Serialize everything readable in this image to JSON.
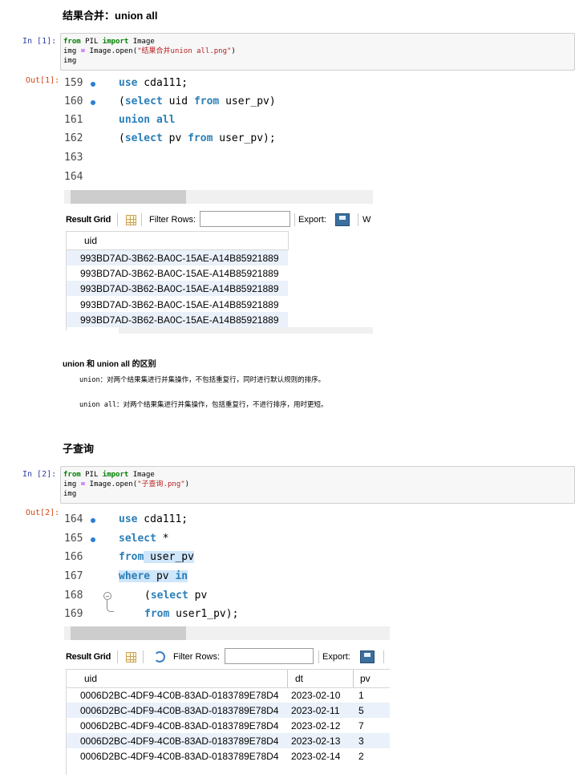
{
  "section1": {
    "heading": "结果合并：union all",
    "in_prompt": "In  [1]:",
    "out_prompt": "Out[1]:",
    "code": {
      "l1_kw1": "from",
      "l1_mod": " PIL ",
      "l1_kw2": "import",
      "l1_rest": " Image",
      "l2_a": "img ",
      "l2_eq": "=",
      "l2_b": " Image.open(",
      "l2_str": "\"结果合并union all.png\"",
      "l2_c": ")",
      "l3": "img"
    },
    "editor": {
      "lines": [
        {
          "num": "159",
          "dot": true,
          "kw": "use",
          "rest": " cda111;"
        },
        {
          "num": "160",
          "dot": true,
          "kw": "",
          "rest": ""
        },
        {
          "num": "161",
          "dot": false,
          "kw": "union all",
          "rest": ""
        },
        {
          "num": "162",
          "dot": false,
          "kw": "",
          "rest": ""
        },
        {
          "num": "163",
          "dot": false,
          "kw": "",
          "rest": ""
        },
        {
          "num": "164",
          "dot": false,
          "kw": "",
          "rest": ""
        }
      ],
      "line160": {
        "p1": "(",
        "k1": "select",
        "p2": " uid ",
        "k2": "from",
        "p3": " user_pv)"
      },
      "line162": {
        "p1": "(",
        "k1": "select",
        "p2": " pv ",
        "k2": "from",
        "p3": " user_pv);"
      }
    },
    "toolbar": {
      "result_grid": "Result Grid",
      "filter_rows": "Filter Rows:",
      "export": "Export:",
      "trailing": "W"
    },
    "grid": {
      "columns": [
        "uid"
      ],
      "rows": [
        [
          "993BD7AD-3B62-BA0C-15AE-A14B85921889"
        ],
        [
          "993BD7AD-3B62-BA0C-15AE-A14B85921889"
        ],
        [
          "993BD7AD-3B62-BA0C-15AE-A14B85921889"
        ],
        [
          "993BD7AD-3B62-BA0C-15AE-A14B85921889"
        ],
        [
          "993BD7AD-3B62-BA0C-15AE-A14B85921889"
        ]
      ]
    }
  },
  "diff": {
    "title": "union 和 union all 的区别",
    "union_line": "union：对两个结果集进行并集操作，不包括重复行，同时进行默认规则的排序。",
    "union_all_line": "union all：对两个结果集进行并集操作，包括重复行，不进行排序，用时更短。"
  },
  "section2": {
    "heading": "子查询",
    "in_prompt": "In  [2]:",
    "out_prompt": "Out[2]:",
    "code": {
      "l1_kw1": "from",
      "l1_mod": " PIL ",
      "l1_kw2": "import",
      "l1_rest": " Image",
      "l2_a": "img ",
      "l2_eq": "=",
      "l2_b": " Image.open(",
      "l2_str": "\"子查询.png\"",
      "l2_c": ")",
      "l3": "img"
    },
    "editor": {
      "n164": "164",
      "n165": "165",
      "n166": "166",
      "n167": "167",
      "n168": "168",
      "n169": "169",
      "l164_kw": "use",
      "l164_rest": " cda111;",
      "l165_kw": "select",
      "l165_rest": " *",
      "l166_kw": "from",
      "l166_rest": " user_pv",
      "l167_kw1": "where",
      "l167_mid": " pv ",
      "l167_kw2": "in",
      "l168_p": "(",
      "l168_kw": "select",
      "l168_rest": " pv",
      "l169_kw": "from",
      "l169_rest": " user1_pv);"
    },
    "toolbar": {
      "result_grid": "Result Grid",
      "filter_rows": "Filter Rows:",
      "export": "Export:"
    },
    "grid": {
      "columns": [
        "uid",
        "dt",
        "pv"
      ],
      "rows": [
        [
          "0006D2BC-4DF9-4C0B-83AD-0183789E78D4",
          "2023-02-10",
          "1"
        ],
        [
          "0006D2BC-4DF9-4C0B-83AD-0183789E78D4",
          "2023-02-11",
          "5"
        ],
        [
          "0006D2BC-4DF9-4C0B-83AD-0183789E78D4",
          "2023-02-12",
          "7"
        ],
        [
          "0006D2BC-4DF9-4C0B-83AD-0183789E78D4",
          "2023-02-13",
          "3"
        ],
        [
          "0006D2BC-4DF9-4C0B-83AD-0183789E78D4",
          "2023-02-14",
          "2"
        ]
      ]
    }
  }
}
